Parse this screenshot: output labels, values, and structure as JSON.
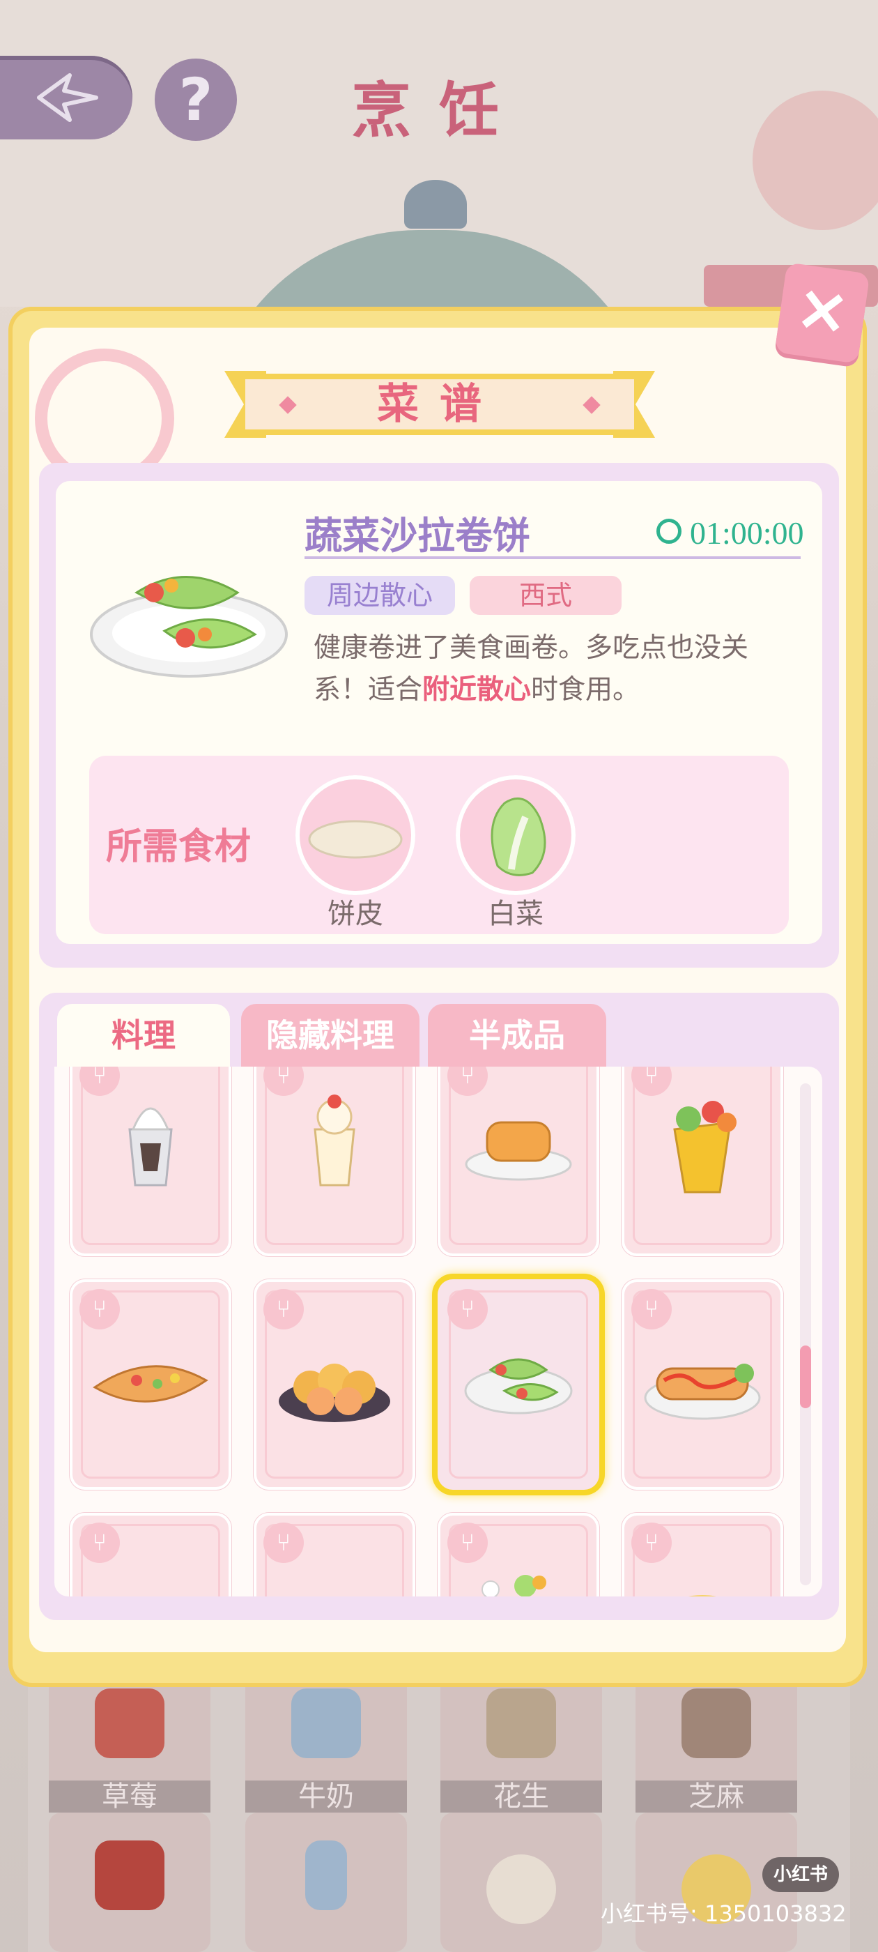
{
  "screen": {
    "title": "烹饪",
    "back_icon": "back-arrow-icon",
    "help_label": "?"
  },
  "recipe_dialog": {
    "title": "菜谱",
    "close_label": "×",
    "dish": {
      "name": "蔬菜沙拉卷饼",
      "cook_time": "01:00:00",
      "tags": [
        "周边散心",
        "西式"
      ],
      "desc_before": "健康卷进了美食画卷。多吃点也没关系！适合",
      "desc_highlight": "附近散心",
      "desc_after": "时食用。"
    },
    "ingredients_title": "所需食材",
    "ingredients": [
      {
        "name": "饼皮",
        "icon": "flatbread-icon"
      },
      {
        "name": "白菜",
        "icon": "cabbage-icon"
      }
    ],
    "tabs": [
      "料理",
      "隐藏料理",
      "半成品"
    ],
    "active_tab": "料理",
    "recipes": [
      {
        "icon": "sundae-icon",
        "selected": false
      },
      {
        "icon": "parfait-icon",
        "selected": false
      },
      {
        "icon": "pancakes-icon",
        "selected": false
      },
      {
        "icon": "wrap-icon",
        "selected": false
      },
      {
        "icon": "flatbread-pizza-icon",
        "selected": false
      },
      {
        "icon": "bread-rolls-icon",
        "selected": false
      },
      {
        "icon": "salad-wrap-icon",
        "selected": true
      },
      {
        "icon": "hotdog-icon",
        "selected": false
      },
      {
        "icon": "empty-recipe-icon",
        "selected": false
      },
      {
        "icon": "empty-recipe-icon",
        "selected": false
      },
      {
        "icon": "dessert-icon",
        "selected": false
      },
      {
        "icon": "dish-icon",
        "selected": false
      }
    ]
  },
  "pantry": {
    "items": [
      "草莓",
      "牛奶",
      "花生",
      "芝麻"
    ],
    "row2_icons": [
      "brown-sugar-icon",
      "milk-bottle-icon",
      "flatbread-stack-icon",
      "whisk-bowl-icon"
    ]
  },
  "watermark": {
    "badge": "小红书",
    "text": "小红书号: 1350103832"
  },
  "colors": {
    "accent_pink": "#ec6a83",
    "accent_purple": "#9b7fc9",
    "timer_green": "#2fb38f",
    "selection_gold": "#f7d628"
  }
}
